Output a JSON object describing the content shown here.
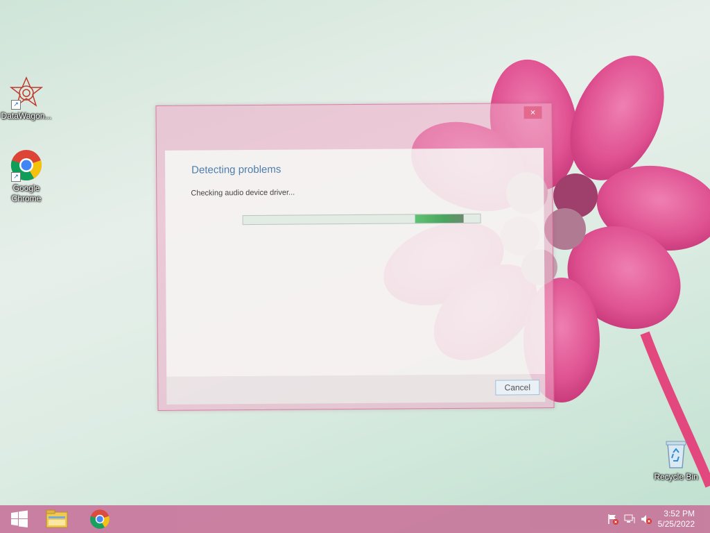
{
  "desktop": {
    "icons": [
      {
        "label": "DataWagon...",
        "icon": "datawagon-icon"
      },
      {
        "label": "Google Chrome",
        "icon": "chrome-icon"
      },
      {
        "label": "Recycle Bin",
        "icon": "recycle-bin-icon"
      }
    ]
  },
  "dialog": {
    "close_label": "×",
    "title": "Detecting problems",
    "status": "Checking audio device driver...",
    "cancel_label": "Cancel"
  },
  "taskbar": {
    "start": "start-button-icon",
    "pinned": [
      "file-explorer-icon",
      "chrome-icon"
    ],
    "tray": [
      "action-center-flag-icon",
      "network-icon",
      "volume-muted-icon"
    ],
    "time": "3:52 PM",
    "date": "5/25/2022"
  },
  "colors": {
    "accent": "#c87a9e",
    "title_text": "#4e7faa",
    "progress": "#4aa45f"
  }
}
